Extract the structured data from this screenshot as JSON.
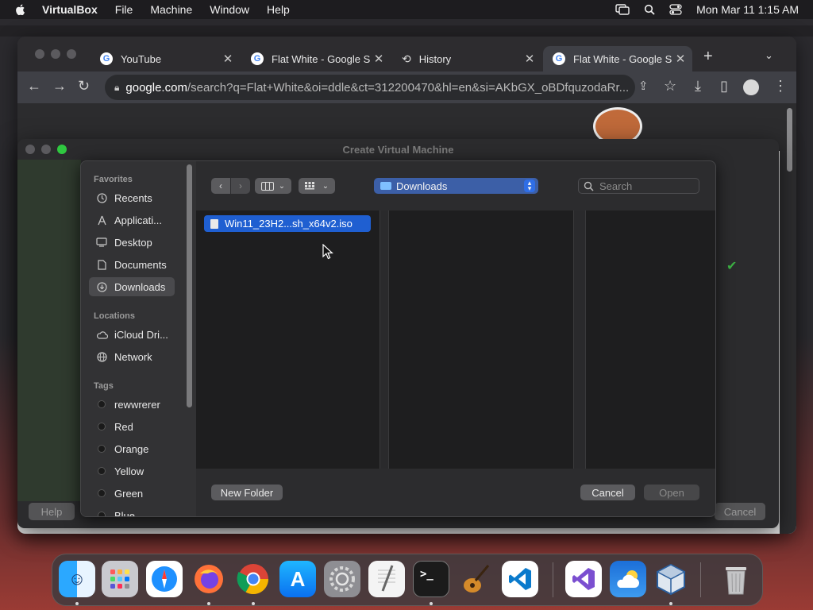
{
  "menubar": {
    "app": "VirtualBox",
    "items": [
      "File",
      "Machine",
      "Window",
      "Help"
    ],
    "datetime": "Mon Mar 11  1:15 AM"
  },
  "chrome": {
    "tabs": [
      {
        "label": "YouTube",
        "active": false
      },
      {
        "label": "Flat White - Google S",
        "active": false
      },
      {
        "label": "History",
        "active": false
      },
      {
        "label": "Flat White - Google S",
        "active": true
      }
    ],
    "new_tab": "+",
    "url_host": "google.com",
    "url_rest": "/search?q=Flat+White&oi=ddle&ct=312200470&hl=en&si=AKbGX_oBDfquzodaRr..."
  },
  "vbox_window": {
    "title": "Create Virtual Machine",
    "help_label": "Help",
    "cancel_label": "Cancel"
  },
  "open_sheet": {
    "sidebar": {
      "favorites_heading": "Favorites",
      "favorites": [
        {
          "label": "Recents",
          "icon": "clock-icon"
        },
        {
          "label": "Applicati...",
          "icon": "applications-icon"
        },
        {
          "label": "Desktop",
          "icon": "desktop-icon"
        },
        {
          "label": "Documents",
          "icon": "document-icon"
        },
        {
          "label": "Downloads",
          "icon": "downloads-icon",
          "selected": true
        }
      ],
      "locations_heading": "Locations",
      "locations": [
        {
          "label": "iCloud Dri...",
          "icon": "cloud-icon"
        },
        {
          "label": "Network",
          "icon": "globe-icon"
        }
      ],
      "tags_heading": "Tags",
      "tags": [
        "rewwrerer",
        "Red",
        "Orange",
        "Yellow",
        "Green",
        "Blue"
      ]
    },
    "location": "Downloads",
    "search_placeholder": "Search",
    "file": "Win11_23H2...sh_x64v2.iso",
    "new_folder_label": "New Folder",
    "cancel_label": "Cancel",
    "open_label": "Open"
  }
}
